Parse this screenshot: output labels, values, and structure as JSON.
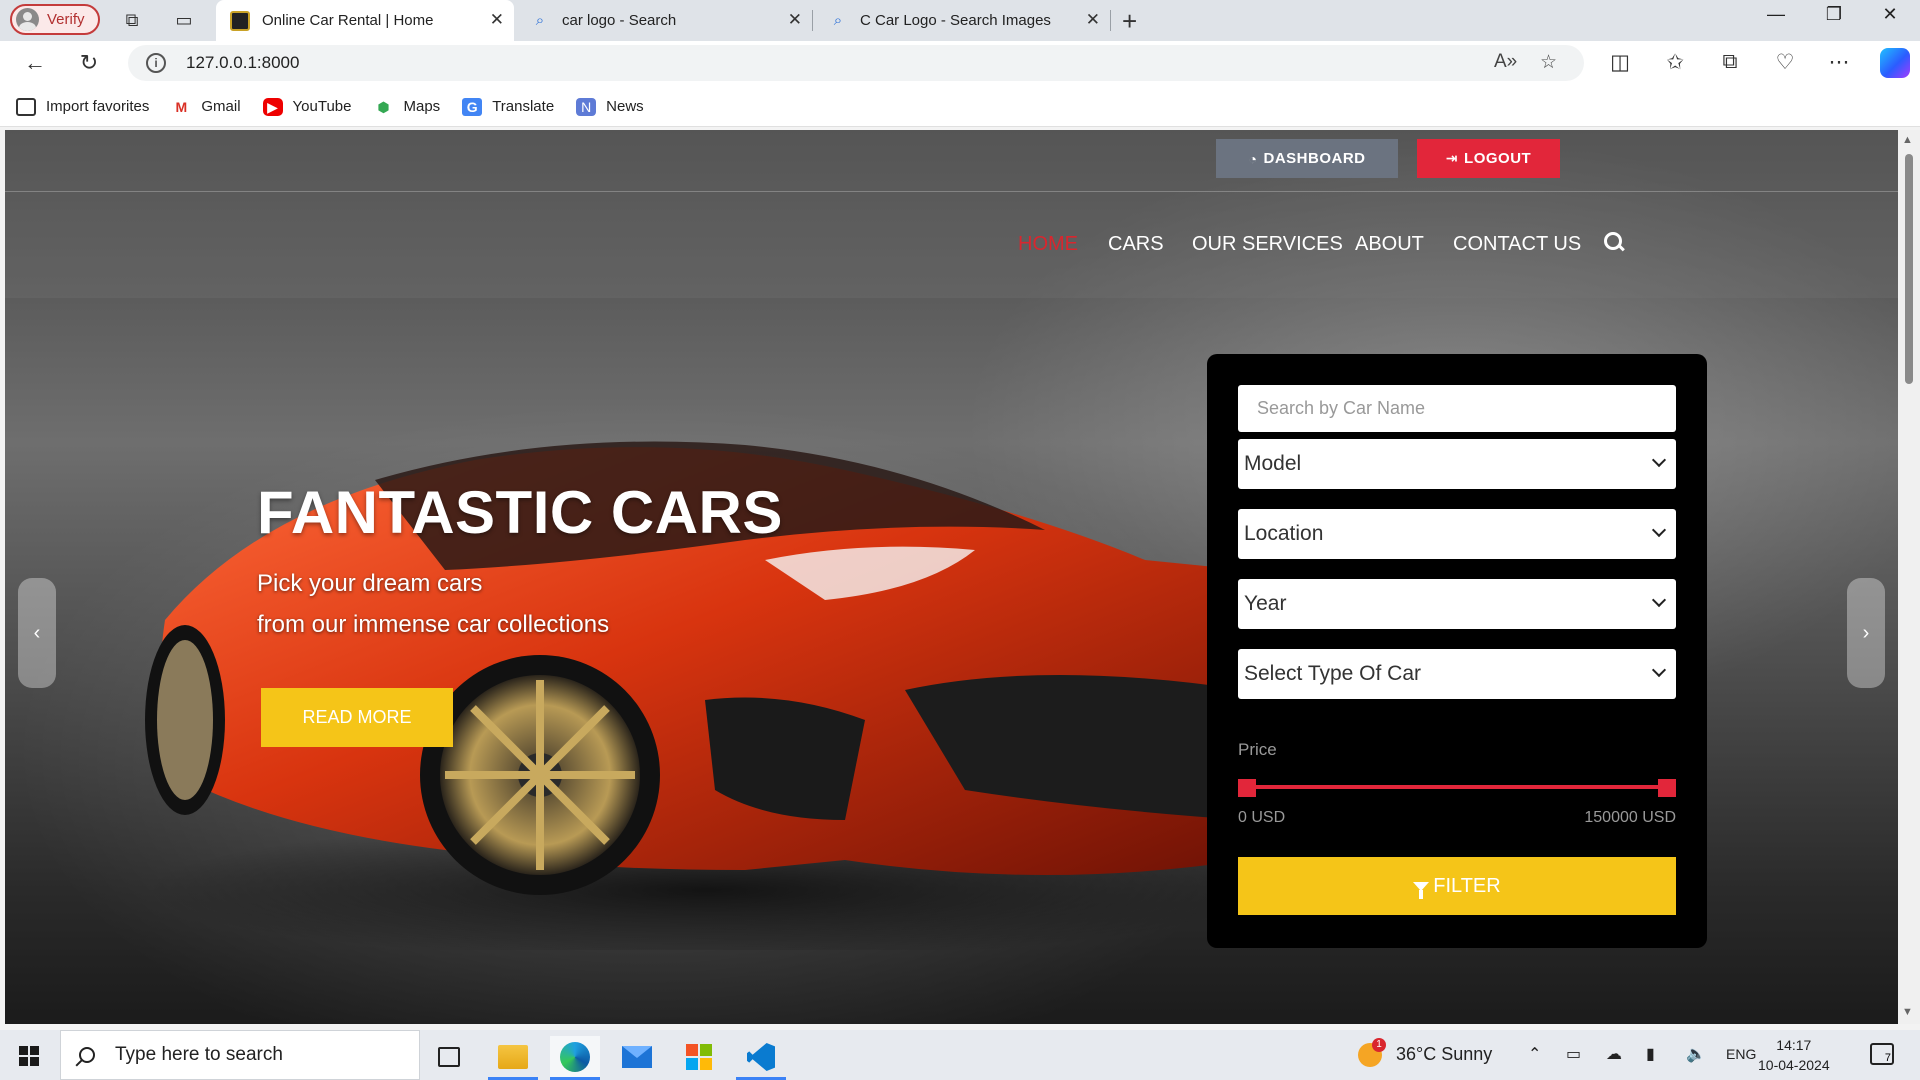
{
  "browser": {
    "profile_label": "Verify",
    "tabs": [
      {
        "title": "Online Car Rental | Home"
      },
      {
        "title": "car logo - Search"
      },
      {
        "title": "C Car Logo - Search Images"
      }
    ],
    "url": "127.0.0.1:8000",
    "favorites": [
      {
        "label": "Import favorites",
        "icon": "import-icon"
      },
      {
        "label": "Gmail",
        "icon": "gmail-icon"
      },
      {
        "label": "YouTube",
        "icon": "youtube-icon"
      },
      {
        "label": "Maps",
        "icon": "maps-icon"
      },
      {
        "label": "Translate",
        "icon": "translate-icon"
      },
      {
        "label": "News",
        "icon": "news-icon"
      }
    ]
  },
  "site": {
    "top_buttons": {
      "dashboard": "DASHBOARD",
      "logout": "LOGOUT"
    },
    "menu": [
      "HOME",
      "CARS",
      "OUR SERVICES",
      "ABOUT",
      "CONTACT US"
    ],
    "active_menu": "HOME",
    "hero": {
      "title": "FANTASTIC CARS",
      "subtitle_line1": "Pick your dream cars",
      "subtitle_line2": "from our immense car collections",
      "button": "READ MORE"
    },
    "filter": {
      "search_placeholder": "Search by Car Name",
      "selects": [
        "Model",
        "Location",
        "Year",
        "Select Type Of Car"
      ],
      "price_label": "Price",
      "price_min": "0 USD",
      "price_max": "150000 USD",
      "price_range": {
        "min": 0,
        "max": 150000
      },
      "button": "FILTER"
    },
    "colors": {
      "accent_yellow": "#f5c518",
      "accent_red": "#e2263a",
      "dashboard_gray": "#6b7380"
    }
  },
  "taskbar": {
    "search_placeholder": "Type here to search",
    "weather": "36°C  Sunny",
    "weather_badge": "1",
    "language": "ENG",
    "time": "14:17",
    "date": "10-04-2024",
    "notifications": "7"
  }
}
